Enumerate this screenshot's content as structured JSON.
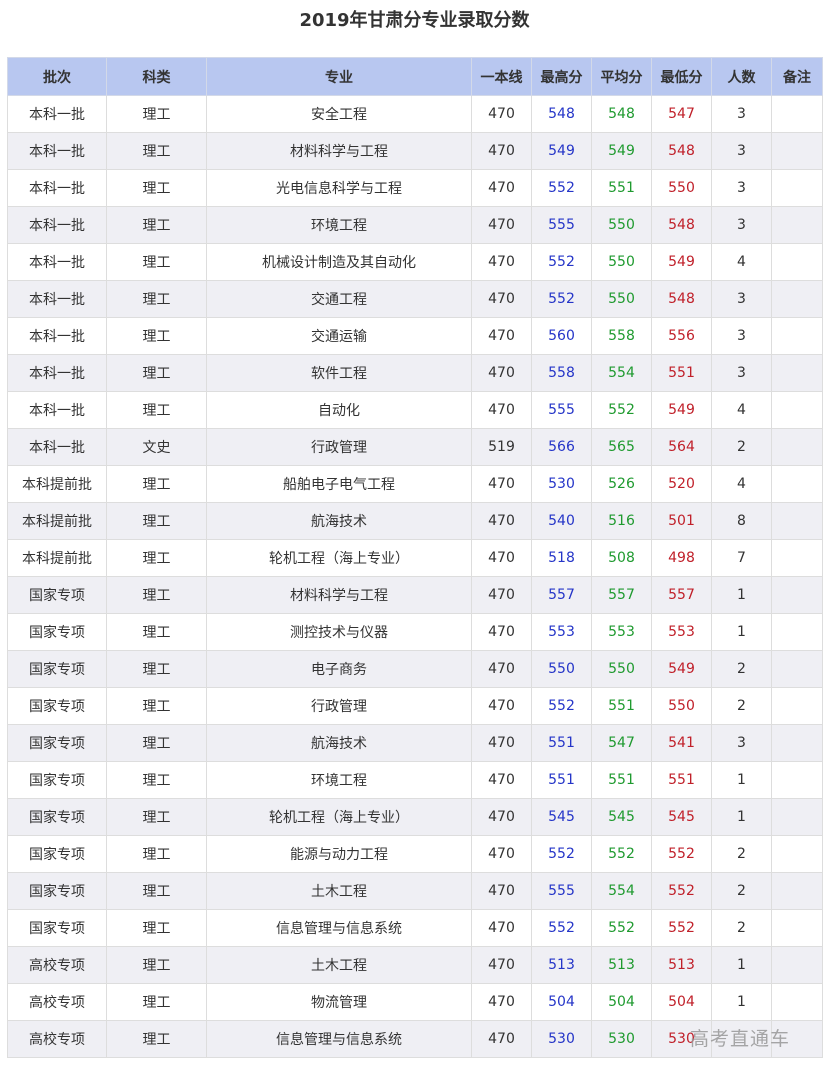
{
  "title": "2019年甘肃分专业录取分数",
  "headers": {
    "batch": "批次",
    "category": "科类",
    "major": "专业",
    "line": "一本线",
    "max": "最高分",
    "avg": "平均分",
    "min": "最低分",
    "count": "人数",
    "note": "备注"
  },
  "colors": {
    "header_bg": "#b8c7f0",
    "max": "#2535c8",
    "avg": "#1f9a2f",
    "min": "#c0202a",
    "row_alt": "#efeff4"
  },
  "rows": [
    {
      "batch": "本科一批",
      "category": "理工",
      "major": "安全工程",
      "line": "470",
      "max": "548",
      "avg": "548",
      "min": "547",
      "count": "3",
      "note": ""
    },
    {
      "batch": "本科一批",
      "category": "理工",
      "major": "材料科学与工程",
      "line": "470",
      "max": "549",
      "avg": "549",
      "min": "548",
      "count": "3",
      "note": ""
    },
    {
      "batch": "本科一批",
      "category": "理工",
      "major": "光电信息科学与工程",
      "line": "470",
      "max": "552",
      "avg": "551",
      "min": "550",
      "count": "3",
      "note": ""
    },
    {
      "batch": "本科一批",
      "category": "理工",
      "major": "环境工程",
      "line": "470",
      "max": "555",
      "avg": "550",
      "min": "548",
      "count": "3",
      "note": ""
    },
    {
      "batch": "本科一批",
      "category": "理工",
      "major": "机械设计制造及其自动化",
      "line": "470",
      "max": "552",
      "avg": "550",
      "min": "549",
      "count": "4",
      "note": ""
    },
    {
      "batch": "本科一批",
      "category": "理工",
      "major": "交通工程",
      "line": "470",
      "max": "552",
      "avg": "550",
      "min": "548",
      "count": "3",
      "note": ""
    },
    {
      "batch": "本科一批",
      "category": "理工",
      "major": "交通运输",
      "line": "470",
      "max": "560",
      "avg": "558",
      "min": "556",
      "count": "3",
      "note": ""
    },
    {
      "batch": "本科一批",
      "category": "理工",
      "major": "软件工程",
      "line": "470",
      "max": "558",
      "avg": "554",
      "min": "551",
      "count": "3",
      "note": ""
    },
    {
      "batch": "本科一批",
      "category": "理工",
      "major": "自动化",
      "line": "470",
      "max": "555",
      "avg": "552",
      "min": "549",
      "count": "4",
      "note": ""
    },
    {
      "batch": "本科一批",
      "category": "文史",
      "major": "行政管理",
      "line": "519",
      "max": "566",
      "avg": "565",
      "min": "564",
      "count": "2",
      "note": ""
    },
    {
      "batch": "本科提前批",
      "category": "理工",
      "major": "船舶电子电气工程",
      "line": "470",
      "max": "530",
      "avg": "526",
      "min": "520",
      "count": "4",
      "note": ""
    },
    {
      "batch": "本科提前批",
      "category": "理工",
      "major": "航海技术",
      "line": "470",
      "max": "540",
      "avg": "516",
      "min": "501",
      "count": "8",
      "note": ""
    },
    {
      "batch": "本科提前批",
      "category": "理工",
      "major": "轮机工程（海上专业）",
      "line": "470",
      "max": "518",
      "avg": "508",
      "min": "498",
      "count": "7",
      "note": ""
    },
    {
      "batch": "国家专项",
      "category": "理工",
      "major": "材料科学与工程",
      "line": "470",
      "max": "557",
      "avg": "557",
      "min": "557",
      "count": "1",
      "note": ""
    },
    {
      "batch": "国家专项",
      "category": "理工",
      "major": "测控技术与仪器",
      "line": "470",
      "max": "553",
      "avg": "553",
      "min": "553",
      "count": "1",
      "note": ""
    },
    {
      "batch": "国家专项",
      "category": "理工",
      "major": "电子商务",
      "line": "470",
      "max": "550",
      "avg": "550",
      "min": "549",
      "count": "2",
      "note": ""
    },
    {
      "batch": "国家专项",
      "category": "理工",
      "major": "行政管理",
      "line": "470",
      "max": "552",
      "avg": "551",
      "min": "550",
      "count": "2",
      "note": ""
    },
    {
      "batch": "国家专项",
      "category": "理工",
      "major": "航海技术",
      "line": "470",
      "max": "551",
      "avg": "547",
      "min": "541",
      "count": "3",
      "note": ""
    },
    {
      "batch": "国家专项",
      "category": "理工",
      "major": "环境工程",
      "line": "470",
      "max": "551",
      "avg": "551",
      "min": "551",
      "count": "1",
      "note": ""
    },
    {
      "batch": "国家专项",
      "category": "理工",
      "major": "轮机工程（海上专业）",
      "line": "470",
      "max": "545",
      "avg": "545",
      "min": "545",
      "count": "1",
      "note": ""
    },
    {
      "batch": "国家专项",
      "category": "理工",
      "major": "能源与动力工程",
      "line": "470",
      "max": "552",
      "avg": "552",
      "min": "552",
      "count": "2",
      "note": ""
    },
    {
      "batch": "国家专项",
      "category": "理工",
      "major": "土木工程",
      "line": "470",
      "max": "555",
      "avg": "554",
      "min": "552",
      "count": "2",
      "note": ""
    },
    {
      "batch": "国家专项",
      "category": "理工",
      "major": "信息管理与信息系统",
      "line": "470",
      "max": "552",
      "avg": "552",
      "min": "552",
      "count": "2",
      "note": ""
    },
    {
      "batch": "高校专项",
      "category": "理工",
      "major": "土木工程",
      "line": "470",
      "max": "513",
      "avg": "513",
      "min": "513",
      "count": "1",
      "note": ""
    },
    {
      "batch": "高校专项",
      "category": "理工",
      "major": "物流管理",
      "line": "470",
      "max": "504",
      "avg": "504",
      "min": "504",
      "count": "1",
      "note": ""
    },
    {
      "batch": "高校专项",
      "category": "理工",
      "major": "信息管理与信息系统",
      "line": "470",
      "max": "530",
      "avg": "530",
      "min": "530",
      "count": "",
      "note": ""
    }
  ],
  "watermark": "高考直通车"
}
